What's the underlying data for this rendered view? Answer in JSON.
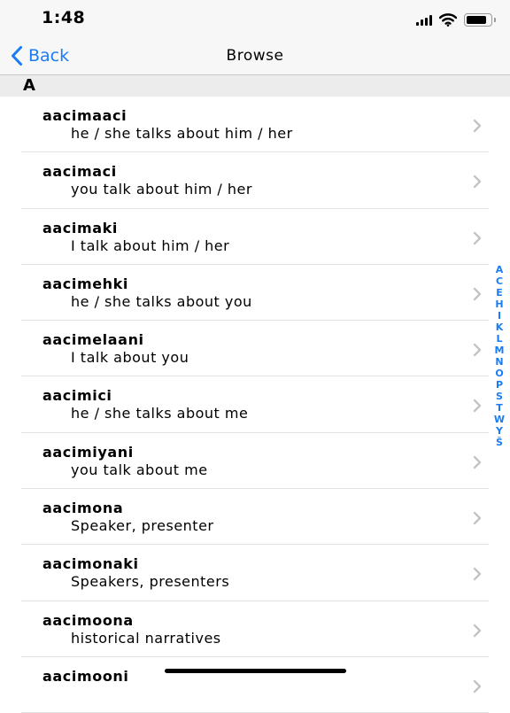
{
  "status_bar": {
    "time": "1:48",
    "battery_level": 0.8
  },
  "nav": {
    "back_label": "Back",
    "title": "Browse"
  },
  "section": {
    "letter": "A"
  },
  "entries": [
    {
      "word": "aacimaaci",
      "gloss": "he / she talks about him / her"
    },
    {
      "word": "aacimaci",
      "gloss": "you talk about him / her"
    },
    {
      "word": "aacimaki",
      "gloss": "I talk about him / her"
    },
    {
      "word": "aacimehki",
      "gloss": "he / she talks about you"
    },
    {
      "word": "aacimelaani",
      "gloss": "I talk about you"
    },
    {
      "word": "aacimici",
      "gloss": "he / she talks about me"
    },
    {
      "word": "aacimiyani",
      "gloss": "you talk about me"
    },
    {
      "word": "aacimona",
      "gloss": "Speaker, presenter"
    },
    {
      "word": "aacimonaki",
      "gloss": "Speakers, presenters"
    },
    {
      "word": "aacimoona",
      "gloss": "historical narratives"
    },
    {
      "word": "aacimooni",
      "gloss": ""
    }
  ],
  "index_letters": [
    "A",
    "C",
    "E",
    "H",
    "I",
    "K",
    "L",
    "M",
    "N",
    "O",
    "P",
    "S",
    "T",
    "W",
    "Y",
    "Š"
  ],
  "colors": {
    "accent": "#1a7cf5",
    "chevron": "#c4c4c7",
    "bar_background": "#f7f7f7",
    "section_background": "#ececec"
  },
  "icons": {
    "back": "chevron-left-icon",
    "row": "chevron-right-icon",
    "signal": "cellular-signal-icon",
    "wifi": "wifi-icon",
    "battery": "battery-icon"
  }
}
